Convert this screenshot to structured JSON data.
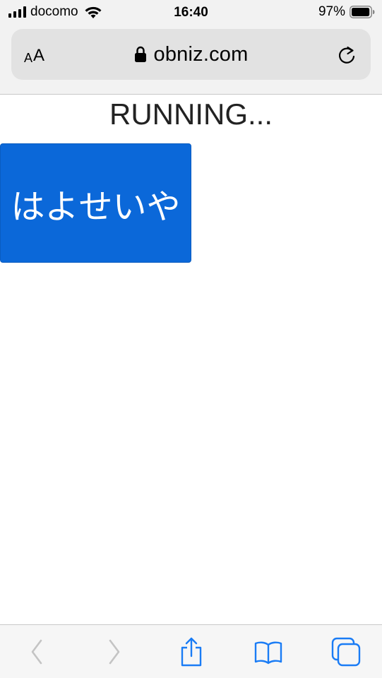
{
  "status_bar": {
    "carrier": "docomo",
    "time": "16:40",
    "battery_percent": "97%",
    "signal_icon": "signal-bars-icon",
    "wifi_icon": "wifi-icon",
    "battery_icon": "battery-icon",
    "battery_level": 0.97
  },
  "address_bar": {
    "text_size_label_small": "A",
    "text_size_label_large": "A",
    "url": "obniz.com",
    "lock_icon": "lock-icon",
    "reload_icon": "reload-icon"
  },
  "page": {
    "heading": "RUNNING...",
    "button_label": "はよせいや",
    "button_color": "#0b68d9"
  },
  "toolbar": {
    "icons": [
      "back-arrow-icon",
      "forward-arrow-icon",
      "share-icon",
      "bookmarks-icon",
      "tabs-icon"
    ],
    "accent_color": "#1a7cf5",
    "disabled_color": "#c4c4c4"
  }
}
